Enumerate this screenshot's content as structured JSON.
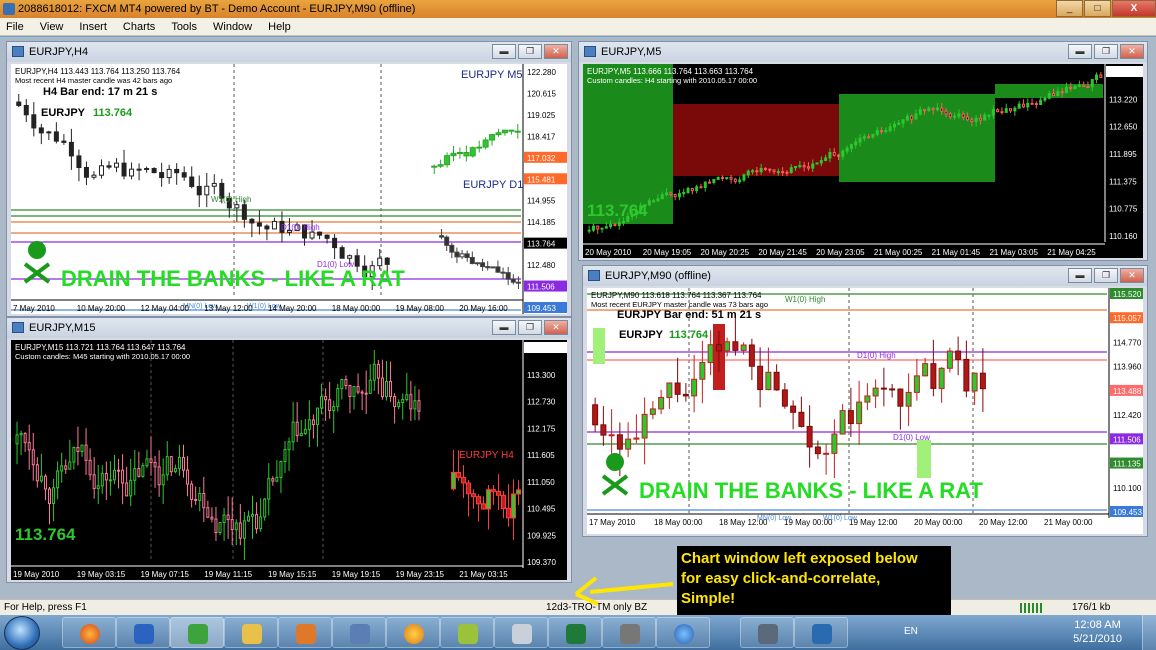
{
  "window": {
    "title": "2088618012: FXCM MT4 powered by BT - Demo Account - EURJPY,M90 (offline)",
    "min": "_",
    "max": "□",
    "close": "X"
  },
  "menu": [
    "File",
    "View",
    "Insert",
    "Charts",
    "Tools",
    "Window",
    "Help"
  ],
  "charts": {
    "h4": {
      "title": "EURJPY,H4",
      "info": "EURJPY,H4  113.443 113.764 113.250 113.764",
      "sub": "Most recent H4 master candle was 42 bars ago",
      "bar_end": "H4 Bar end: 17 m 21 s",
      "symbol": "EURJPY",
      "price_label": "113.764",
      "tag_m5": "EURJPY M5",
      "tag_d1": "EURJPY D1",
      "banner": "DRAIN THE BANKS - LIKE A RAT",
      "levels": [
        "W1(0) High",
        "D1(0) High",
        "D1(0) Low",
        "MN(0) Low",
        "W1(0) Low"
      ],
      "y_ticks": [
        "122.280",
        "120.615",
        "119.025",
        "118.417",
        "117.032",
        "115.481",
        "114.955",
        "114.185",
        "113.764",
        "112.480",
        "111.506",
        "109.453"
      ],
      "x_ticks": [
        "7 May 2010",
        "10 May 20:00",
        "12 May 04:00",
        "13 May 12:00",
        "14 May 20:00",
        "18 May 00:00",
        "19 May 08:00",
        "20 May 16:00"
      ]
    },
    "m5": {
      "title": "EURJPY,M5",
      "info": "EURJPY,M5  113.666 113.764 113.663 113.764",
      "sub": "Custom candles: H4 starting with 2010.05.17 00:00",
      "big_price": "113.764",
      "y_ticks": [
        "113.764",
        "113.220",
        "112.650",
        "111.895",
        "111.375",
        "110.775",
        "110.160"
      ],
      "x_ticks": [
        "20 May 2010",
        "20 May 19:05",
        "20 May 20:25",
        "20 May 21:45",
        "20 May 23:05",
        "21 May 00:25",
        "21 May 01:45",
        "21 May 03:05",
        "21 May 04:25"
      ]
    },
    "m15": {
      "title": "EURJPY,M15",
      "info": "EURJPY,M15  113.721 113.764 113.647 113.764",
      "sub": "Custom candles: M45 starting with 2010.05.17 00:00",
      "big_price": "113.764",
      "tag_h4": "EURJPY H4",
      "y_ticks": [
        "113.764",
        "113.300",
        "112.730",
        "112.175",
        "111.605",
        "111.050",
        "110.495",
        "109.925",
        "109.370"
      ],
      "x_ticks": [
        "19 May 2010",
        "19 May 03:15",
        "19 May 07:15",
        "19 May 11:15",
        "19 May 15:15",
        "19 May 19:15",
        "19 May 23:15",
        "21 May 03:15"
      ]
    },
    "m90": {
      "title": "EURJPY,M90 (offline)",
      "info": "EURJPY,M90  113.618 113.764 113.367 113.764",
      "sub": "Most recent EURJPY master candle was 73 bars ago",
      "bar_end": "EURJPY Bar end: 51 m 21 s",
      "symbol": "EURJPY",
      "price_label": "113.764",
      "banner": "DRAIN THE BANKS - LIKE A RAT",
      "levels": [
        "W1(0) High",
        "D1(0) High",
        "D1(0) Low",
        "MN(0) Low",
        "W1(0) Low"
      ],
      "y_ticks": [
        "115.520",
        "115.057",
        "114.770",
        "113.960",
        "113.488",
        "112.420",
        "111.506",
        "111.135",
        "110.100",
        "109.453"
      ],
      "x_ticks": [
        "17 May 2010",
        "18 May 00:00",
        "18 May 12:00",
        "19 May 00:00",
        "19 May 12:00",
        "20 May 00:00",
        "20 May 12:00",
        "21 May 00:00"
      ]
    }
  },
  "status": {
    "help": "For Help, press F1",
    "profile": "12d3-TRO-TM only BZ",
    "traffic": "176/1 kb"
  },
  "annotation": {
    "line1": "Chart window left exposed below",
    "line2": "for easy click-and-correlate,",
    "line3": "Simple!"
  },
  "tray": {
    "lang": "EN",
    "time": "12:08 AM",
    "date": "5/21/2010"
  },
  "colors": {
    "bull": "#2ec82e",
    "bear": "#c21f1f",
    "level_purple": "#8a2be2",
    "level_green": "#2e8b2e",
    "level_orange": "#e8783a",
    "highlight_red": "#7a0a0a",
    "highlight_green": "#1a8a1a",
    "banner_green": "#22dd22"
  }
}
